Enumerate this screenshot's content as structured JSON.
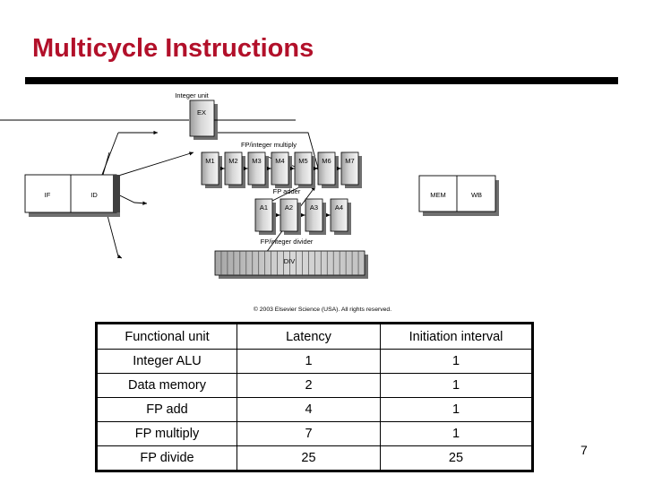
{
  "slide": {
    "title": "Multicycle Instructions",
    "page_number": "7",
    "title_color": "#b2102a",
    "rule_color": "#000000"
  },
  "figure": {
    "copyright": "© 2003 Elsevier Science (USA). All rights reserved.",
    "group_labels": {
      "integer_unit": "Integer unit",
      "fp_integer_multiply": "FP/integer multiply",
      "fp_adder": "FP adder",
      "fp_integer_divider": "FP/integer divider"
    },
    "front_stages": [
      "IF",
      "ID"
    ],
    "integer_stage": "EX",
    "multiply_stages": [
      "M1",
      "M2",
      "M3",
      "M4",
      "M5",
      "M6",
      "M7"
    ],
    "adder_stages": [
      "A1",
      "A2",
      "A3",
      "A4"
    ],
    "divider_stage": "DIV",
    "divider_segments": 24,
    "back_stages": [
      "MEM",
      "WB"
    ]
  },
  "table": {
    "headers": [
      "Functional unit",
      "Latency",
      "Initiation interval"
    ],
    "rows": [
      [
        "Integer ALU",
        "1",
        "1"
      ],
      [
        "Data memory",
        "2",
        "1"
      ],
      [
        "FP add",
        "4",
        "1"
      ],
      [
        "FP multiply",
        "7",
        "1"
      ],
      [
        "FP divide",
        "25",
        "25"
      ]
    ]
  }
}
